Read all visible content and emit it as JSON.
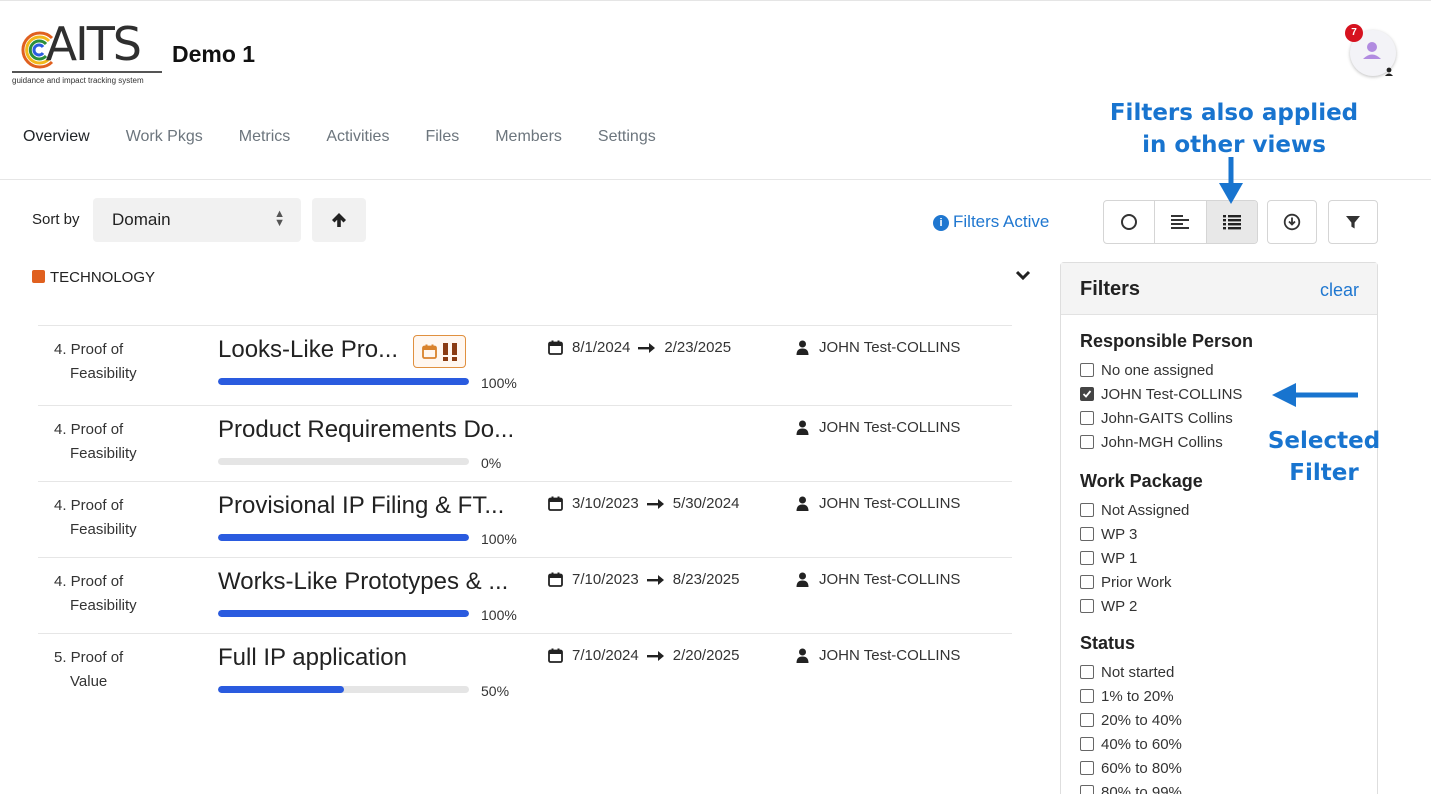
{
  "header": {
    "logo_text": "GAITS",
    "logo_tagline": "guidance and impact tracking system",
    "project_title": "Demo 1",
    "notification_count": "7"
  },
  "tabs": [
    {
      "label": "Overview",
      "active": true
    },
    {
      "label": "Work Pkgs",
      "active": false
    },
    {
      "label": "Metrics",
      "active": false
    },
    {
      "label": "Activities",
      "active": false
    },
    {
      "label": "Files",
      "active": false
    },
    {
      "label": "Members",
      "active": false
    },
    {
      "label": "Settings",
      "active": false
    }
  ],
  "toolbar": {
    "sort_label": "Sort by",
    "sort_value": "Domain",
    "filters_status": "Filters Active"
  },
  "domain": {
    "label": "TECHNOLOGY",
    "color": "#e0601f"
  },
  "rows": [
    {
      "phase_line1": "4. Proof of",
      "phase_line2": "Feasibility",
      "title": "Looks-Like Pro...",
      "progress": 100,
      "progress_label": "100%",
      "start": "8/1/2024",
      "end": "2/23/2025",
      "person": "JOHN Test-COLLINS",
      "has_dates": true,
      "has_icons": true
    },
    {
      "phase_line1": "4. Proof of",
      "phase_line2": "Feasibility",
      "title": "Product Requirements Do...",
      "progress": 0,
      "progress_label": "0%",
      "start": "",
      "end": "",
      "person": "JOHN Test-COLLINS",
      "has_dates": false,
      "has_icons": false
    },
    {
      "phase_line1": "4. Proof of",
      "phase_line2": "Feasibility",
      "title": "Provisional IP Filing & FT...",
      "progress": 100,
      "progress_label": "100%",
      "start": "3/10/2023",
      "end": "5/30/2024",
      "person": "JOHN Test-COLLINS",
      "has_dates": true,
      "has_icons": false
    },
    {
      "phase_line1": "4. Proof of",
      "phase_line2": "Feasibility",
      "title": "Works-Like Prototypes & ...",
      "progress": 100,
      "progress_label": "100%",
      "start": "7/10/2023",
      "end": "8/23/2025",
      "person": "JOHN Test-COLLINS",
      "has_dates": true,
      "has_icons": false
    },
    {
      "phase_line1": "5. Proof of",
      "phase_line2": "Value",
      "title": "Full IP application",
      "progress": 50,
      "progress_label": "50%",
      "start": "7/10/2024",
      "end": "2/20/2025",
      "person": "JOHN Test-COLLINS",
      "has_dates": true,
      "has_icons": false
    }
  ],
  "filters": {
    "title": "Filters",
    "clear_label": "clear",
    "groups": [
      {
        "heading": "Responsible Person",
        "options": [
          {
            "label": "No one assigned",
            "checked": false
          },
          {
            "label": "JOHN Test-COLLINS",
            "checked": true
          },
          {
            "label": "John-GAITS Collins",
            "checked": false
          },
          {
            "label": "John-MGH Collins",
            "checked": false
          }
        ]
      },
      {
        "heading": "Work Package",
        "options": [
          {
            "label": "Not Assigned",
            "checked": false
          },
          {
            "label": "WP 3",
            "checked": false
          },
          {
            "label": "WP 1",
            "checked": false
          },
          {
            "label": "Prior Work",
            "checked": false
          },
          {
            "label": "WP 2",
            "checked": false
          }
        ]
      },
      {
        "heading": "Status",
        "options": [
          {
            "label": "Not started",
            "checked": false
          },
          {
            "label": "1% to 20%",
            "checked": false
          },
          {
            "label": "20% to 40%",
            "checked": false
          },
          {
            "label": "40% to 60%",
            "checked": false
          },
          {
            "label": "60% to 80%",
            "checked": false
          },
          {
            "label": "80% to 99%",
            "checked": false
          }
        ]
      }
    ]
  },
  "annotations": {
    "views_note_line1": "Filters also applied",
    "views_note_line2": "in other views",
    "selected_note_line1": "Selected",
    "selected_note_line2": "Filter",
    "color": "#1874cf"
  },
  "colors": {
    "accent": "#1f77d0",
    "progress": "#2a5bdf",
    "badge": "#d6121f",
    "highlight": "#ffff1a"
  }
}
